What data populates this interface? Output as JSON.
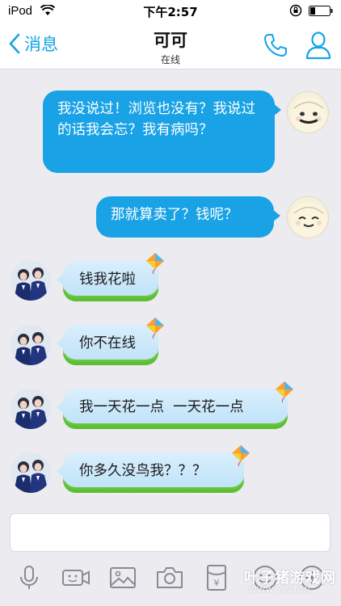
{
  "status_bar": {
    "carrier": "iPod",
    "time": "下午2:57"
  },
  "nav": {
    "back_label": "消息",
    "title": "可可",
    "subtitle": "在线"
  },
  "messages": [
    {
      "side": "right",
      "text": "我没说过！浏览也没有？我说过的话我会忘？我有病吗？"
    },
    {
      "side": "right",
      "text": "那就算卖了？钱呢？"
    },
    {
      "side": "left",
      "text": "钱我花啦"
    },
    {
      "side": "left",
      "text": "你不在线"
    },
    {
      "side": "left",
      "text": "我一天花一点  一天花一点"
    },
    {
      "side": "left",
      "text": "你多久没鸟我？？？"
    }
  ],
  "input": {
    "placeholder": ""
  },
  "toolbar": {
    "icons": [
      "microphone-icon",
      "video-icon",
      "image-icon",
      "camera-icon",
      "red-packet-icon",
      "emoji-icon",
      "plus-icon"
    ]
  },
  "watermark": {
    "title": "叶子猪游戏网",
    "url": "WWW.YZZ.CN"
  },
  "colors": {
    "accent": "#12a4e8",
    "bubble_out": "#19a2e6"
  }
}
